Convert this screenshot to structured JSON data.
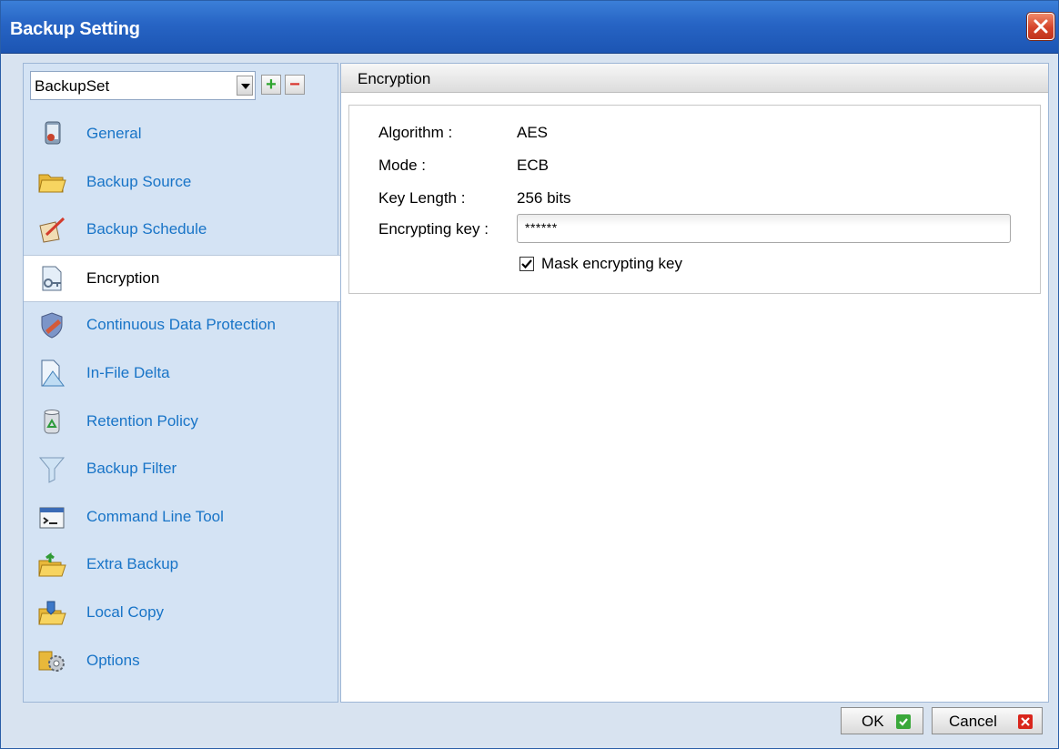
{
  "window": {
    "title": "Backup Setting",
    "close_icon": "close-x-icon"
  },
  "sidebar": {
    "backup_set_value": "BackupSet",
    "add_label": "+",
    "remove_label": "−",
    "items": [
      {
        "label": "General",
        "icon": "general-icon"
      },
      {
        "label": "Backup Source",
        "icon": "folder-icon"
      },
      {
        "label": "Backup Schedule",
        "icon": "schedule-icon"
      },
      {
        "label": "Encryption",
        "icon": "encryption-key-icon",
        "active": true
      },
      {
        "label": "Continuous Data Protection",
        "icon": "shield-icon"
      },
      {
        "label": "In-File Delta",
        "icon": "delta-icon"
      },
      {
        "label": "Retention Policy",
        "icon": "recycle-bin-icon"
      },
      {
        "label": "Backup Filter",
        "icon": "filter-funnel-icon"
      },
      {
        "label": "Command Line Tool",
        "icon": "command-line-icon"
      },
      {
        "label": "Extra Backup",
        "icon": "extra-backup-icon"
      },
      {
        "label": "Local Copy",
        "icon": "local-copy-icon"
      },
      {
        "label": "Options",
        "icon": "options-gear-icon"
      }
    ]
  },
  "content": {
    "header": "Encryption",
    "algorithm_label": "Algorithm :",
    "algorithm_value": "AES",
    "mode_label": "Mode :",
    "mode_value": "ECB",
    "key_length_label": "Key Length :",
    "key_length_value": "256 bits",
    "encrypting_key_label": "Encrypting key :",
    "encrypting_key_value": "******",
    "mask_label": "Mask encrypting key",
    "mask_checked": true
  },
  "footer": {
    "ok_label": "OK",
    "cancel_label": "Cancel"
  },
  "colors": {
    "titlebar": "#2764c4",
    "link": "#1874c7",
    "ok": "#3aa83a",
    "cancel": "#d9261c"
  }
}
